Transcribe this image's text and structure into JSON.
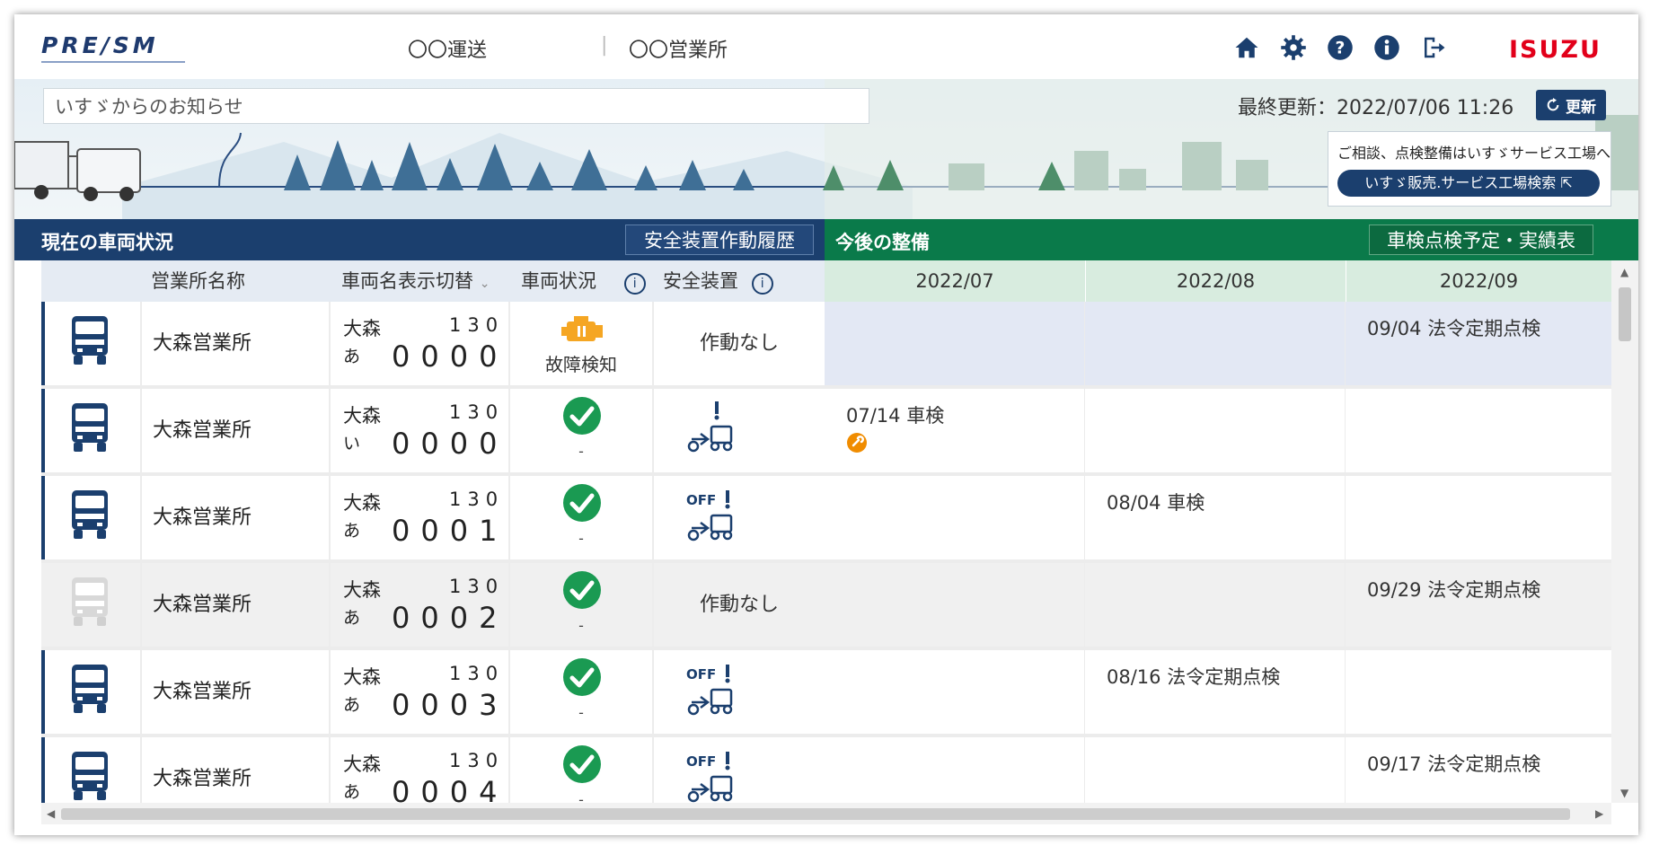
{
  "header": {
    "logo": "PRE/SM",
    "company": "〇〇運送",
    "separator": "|",
    "office": "〇〇営業所",
    "brand": "ISUZU"
  },
  "banner": {
    "notice": "いすゞからのお知らせ",
    "last_update": "最終更新：2022/07/06 11:26",
    "refresh_label": "更新",
    "dealer_note": "ご相談、点検整備はいすゞサービス工場へ",
    "dealer_button": "いすゞ販売.サービス工場検索"
  },
  "sections": {
    "left_title": "現在の車両状況",
    "left_button": "安全装置作動履歴",
    "right_title": "今後の整備",
    "right_button": "車検点検予定・実績表"
  },
  "columns": {
    "office": "営業所名称",
    "vehicle": "車両名表示切替",
    "status": "車両状況",
    "safety": "安全装置",
    "months": [
      "2022/07",
      "2022/08",
      "2022/09"
    ]
  },
  "rows": [
    {
      "office": "大森営業所",
      "area": "大森",
      "cls": "130",
      "kana": "あ",
      "num": "0000",
      "status": "fault",
      "status_text": "故障検知",
      "safety": "text",
      "safety_text": "作動なし",
      "m1": "",
      "m2": "",
      "m3": "09/04 法令定期点検"
    },
    {
      "office": "大森営業所",
      "area": "大森",
      "cls": "130",
      "kana": "い",
      "num": "0000",
      "status": "ok",
      "status_text": "-",
      "safety": "alert",
      "safety_text": "",
      "m1": "07/14 車検",
      "m2": "",
      "m3": ""
    },
    {
      "office": "大森営業所",
      "area": "大森",
      "cls": "130",
      "kana": "あ",
      "num": "0001",
      "status": "ok",
      "status_text": "-",
      "safety": "off",
      "safety_text": "OFF",
      "m1": "",
      "m2": "08/04 車検",
      "m3": ""
    },
    {
      "office": "大森営業所",
      "area": "大森",
      "cls": "130",
      "kana": "あ",
      "num": "0002",
      "status": "ok",
      "status_text": "-",
      "safety": "text",
      "safety_text": "作動なし",
      "m1": "",
      "m2": "",
      "m3": "09/29 法令定期点検"
    },
    {
      "office": "大森営業所",
      "area": "大森",
      "cls": "130",
      "kana": "あ",
      "num": "0003",
      "status": "ok",
      "status_text": "-",
      "safety": "off",
      "safety_text": "OFF",
      "m1": "",
      "m2": "08/16 法令定期点検",
      "m3": ""
    },
    {
      "office": "大森営業所",
      "area": "大森",
      "cls": "130",
      "kana": "あ",
      "num": "0004",
      "status": "ok",
      "status_text": "-",
      "safety": "off",
      "safety_text": "OFF",
      "m1": "",
      "m2": "",
      "m3": "09/17 法令定期点検"
    }
  ],
  "colors": {
    "navy": "#1b3f6e",
    "green": "#0a7a4a",
    "ok": "#1a9a52",
    "fault": "#f5a623",
    "brand_red": "#e2001a"
  }
}
